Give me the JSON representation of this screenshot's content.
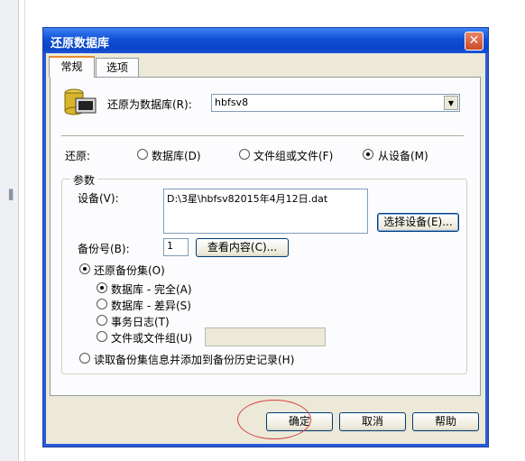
{
  "window": {
    "title": "还原数据库"
  },
  "tabs": [
    {
      "label": "常规",
      "active": true
    },
    {
      "label": "选项",
      "active": false
    }
  ],
  "restore_as": {
    "label": "还原为数据库(R):",
    "value": "hbfsv8"
  },
  "restore_from": {
    "label": "还原:",
    "options": [
      {
        "label": "数据库(D)",
        "selected": false
      },
      {
        "label": "文件组或文件(F)",
        "selected": false
      },
      {
        "label": "从设备(M)",
        "selected": true
      }
    ]
  },
  "params": {
    "group_label": "参数",
    "device_label": "设备(V):",
    "device_value": "D:\\3星\\hbfsv82015年4月12日.dat",
    "select_device_button": "选择设备(E)...",
    "backup_no_label": "备份号(B):",
    "backup_no_value": "1",
    "view_contents_button": "查看内容(C)...",
    "restore_backup_set": {
      "label": "还原备份集(O)",
      "selected": true
    },
    "backup_types": [
      {
        "label": "数据库 - 完全(A)",
        "selected": true
      },
      {
        "label": "数据库 - 差异(S)",
        "selected": false
      },
      {
        "label": "事务日志(T)",
        "selected": false
      },
      {
        "label": "文件或文件组(U)",
        "selected": false
      }
    ],
    "file_group_value": "",
    "read_history": {
      "label": "读取备份集信息并添加到备份历史记录(H)",
      "selected": false
    }
  },
  "buttons": {
    "ok": "确定",
    "cancel": "取消",
    "help": "帮助"
  },
  "colors": {
    "title_bar": "#0a45c8",
    "dialog_bg": "#ece9d8",
    "annotation": "#d64040"
  }
}
